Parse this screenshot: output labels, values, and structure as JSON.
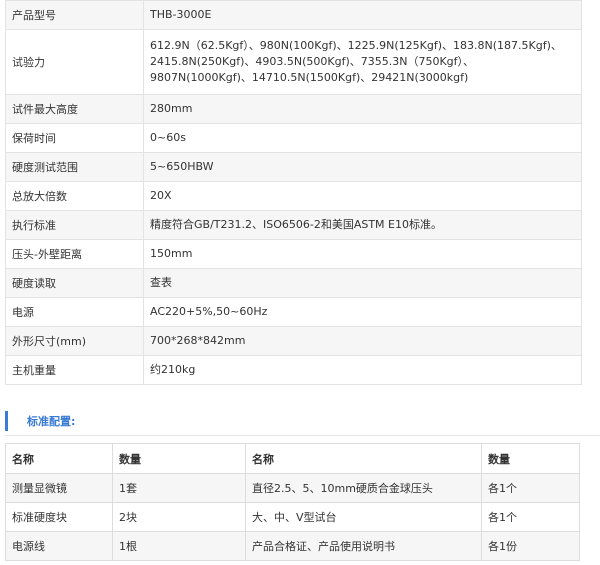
{
  "specs": [
    {
      "label": "产品型号",
      "value": "THB-3000E"
    },
    {
      "label": "试验力",
      "value": "612.9N（62.5Kgf）、980N(100Kgf)、1225.9N(125Kgf)、183.8N(187.5Kgf)、2415.8N(250Kgf)、4903.5N(500Kgf)、7355.3N（750Kgf）、9807N(1000Kgf)、14710.5N(1500Kgf)、29421N(3000kgf)"
    },
    {
      "label": "试件最大高度",
      "value": "280mm"
    },
    {
      "label": "保荷时间",
      "value": "0~60s"
    },
    {
      "label": "硬度测试范围",
      "value": "5~650HBW"
    },
    {
      "label": "总放大倍数",
      "value": "20X"
    },
    {
      "label": "执行标准",
      "value": "精度符合GB/T231.2、ISO6506-2和美国ASTM E10标准。"
    },
    {
      "label": "压头-外壁距离",
      "value": "150mm"
    },
    {
      "label": "硬度读取",
      "value": "查表"
    },
    {
      "label": "电源",
      "value": "AC220+5%,50~60Hz"
    },
    {
      "label": "外形尺寸(mm)",
      "value": "700*268*842mm"
    },
    {
      "label": "主机重量",
      "value": "约210kg"
    }
  ],
  "config": {
    "title": "标准配置:",
    "headers": [
      "名称",
      "数量",
      "名称",
      "数量"
    ],
    "rows": [
      [
        "测量显微镜",
        "1套",
        "直径2.5、5、10mm硬质合金球压头",
        "各1个"
      ],
      [
        "标准硬度块",
        "2块",
        "大、中、V型试台",
        "各1个"
      ],
      [
        "电源线",
        "1根",
        "产品合格证、产品使用说明书",
        "各1份"
      ]
    ]
  },
  "colors": {
    "accent": "#3a7bd5",
    "stripe": "#f6f6f6",
    "border": "#e3e3e3"
  }
}
